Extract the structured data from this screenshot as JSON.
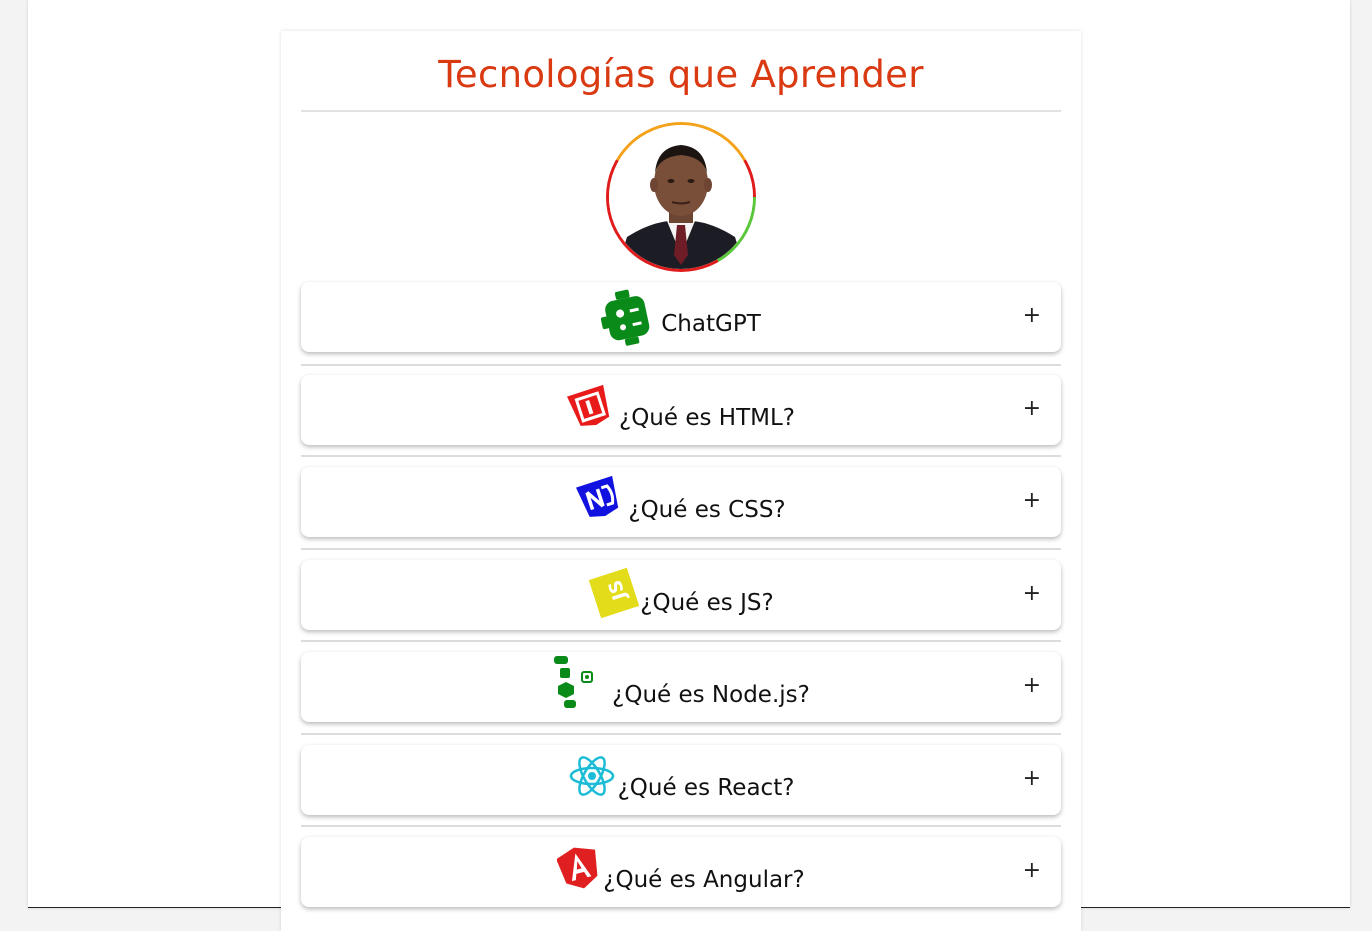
{
  "title": "Tecnologías que Aprender",
  "colors": {
    "title": "#d93a12",
    "ring_top": "#f3a21a",
    "ring_side": "#e01b1b",
    "ring_bottom": "#5ac73a"
  },
  "avatar": {
    "icon": "profile-photo"
  },
  "accordion": [
    {
      "label": "ChatGPT",
      "icon": "chatgpt-logo-icon",
      "toggle": "+"
    },
    {
      "label": "¿Qué es HTML?",
      "icon": "html-logo-icon",
      "toggle": "+"
    },
    {
      "label": "¿Qué es CSS?",
      "icon": "css-logo-icon",
      "toggle": "+"
    },
    {
      "label": "¿Qué es JS?",
      "icon": "js-logo-icon",
      "toggle": "+"
    },
    {
      "label": "¿Qué es Node.js?",
      "icon": "nodejs-logo-icon",
      "toggle": "+"
    },
    {
      "label": "¿Qué es React?",
      "icon": "react-logo-icon",
      "toggle": "+"
    },
    {
      "label": "¿Qué es Angular?",
      "icon": "angular-logo-icon",
      "toggle": "+"
    }
  ]
}
